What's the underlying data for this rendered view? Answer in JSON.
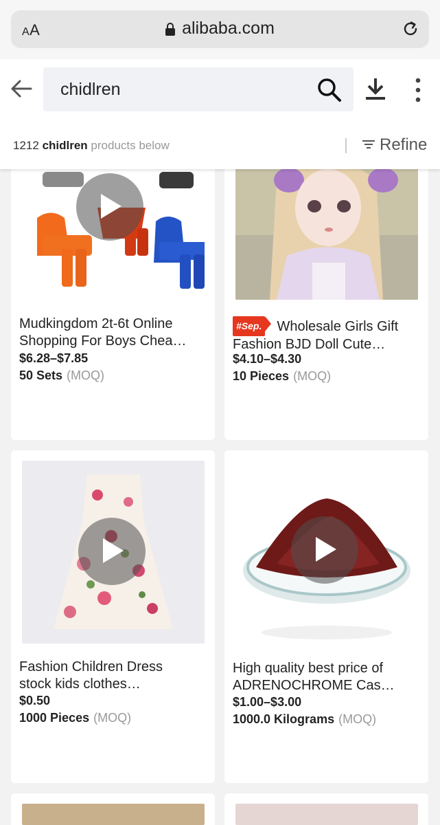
{
  "browser": {
    "text_size_label": "AA",
    "url": "alibaba.com"
  },
  "header": {
    "search_query": "chidlren",
    "result_count": "1212",
    "result_keyword": "chidlren",
    "result_suffix": "products below",
    "refine_label": "Refine"
  },
  "products": [
    {
      "title_line1": "Mudkingdom 2t-6t Online",
      "title_line2": "Shopping For Boys Chea…",
      "price": "$6.28–$7.85",
      "moq_qty": "50 Sets",
      "moq_label": "(MOQ)",
      "has_video": true
    },
    {
      "badge": "#Sep.",
      "title_line1": "Wholesale Girls Gift",
      "title_line2": "Fashion BJD Doll Cute…",
      "price": "$4.10–$4.30",
      "moq_qty": "10 Pieces",
      "moq_label": "(MOQ)",
      "has_video": false
    },
    {
      "title_line1": "Fashion Children Dress",
      "title_line2": "stock kids clothes…",
      "price": "$0.50",
      "moq_qty": "1000 Pieces",
      "moq_label": "(MOQ)",
      "has_video": true
    },
    {
      "title_line1": "High quality best price of",
      "title_line2": "ADRENOCHROME Cas…",
      "price": "$1.00–$3.00",
      "moq_qty": "1000.0 Kilograms",
      "moq_label": "(MOQ)",
      "has_video": true
    }
  ],
  "colors": {
    "badge": "#e6371f",
    "background": "#f2f2f2"
  }
}
